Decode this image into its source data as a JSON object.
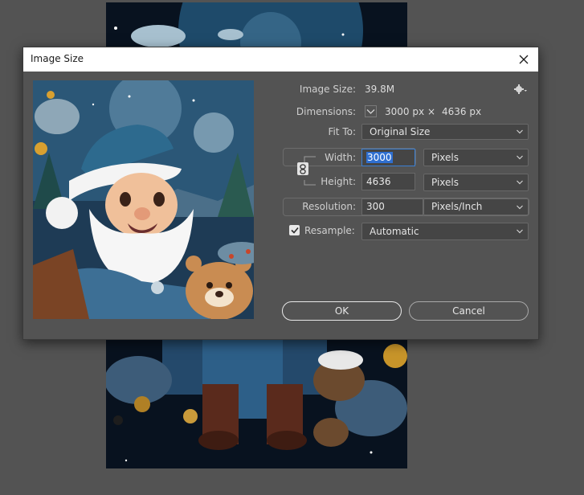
{
  "dialog": {
    "title": "Image Size",
    "image_size_label": "Image Size:",
    "image_size_value": "39.8M",
    "dimensions_label": "Dimensions:",
    "dimensions_width": "3000 px",
    "dimensions_times": "×",
    "dimensions_height": "4636 px",
    "fit_to_label": "Fit To:",
    "fit_to_value": "Original Size",
    "width_label": "Width:",
    "width_value": "3000",
    "width_unit": "Pixels",
    "height_label": "Height:",
    "height_value": "4636",
    "height_unit": "Pixels",
    "resolution_label": "Resolution:",
    "resolution_value": "300",
    "resolution_unit": "Pixels/Inch",
    "resample_label": "Resample:",
    "resample_checked": true,
    "resample_value": "Automatic",
    "ok_label": "OK",
    "cancel_label": "Cancel"
  },
  "icons": {
    "close": "close-icon",
    "settings": "gear-icon",
    "dimensions_toggle": "chevron-down-icon",
    "constrain": "chain-link-icon",
    "resample_check": "checkmark-icon"
  },
  "colors": {
    "dialog_bg": "#535353",
    "field_bg": "#454545",
    "selection": "#2f6fd0",
    "focus_border": "#3a7fd4"
  }
}
